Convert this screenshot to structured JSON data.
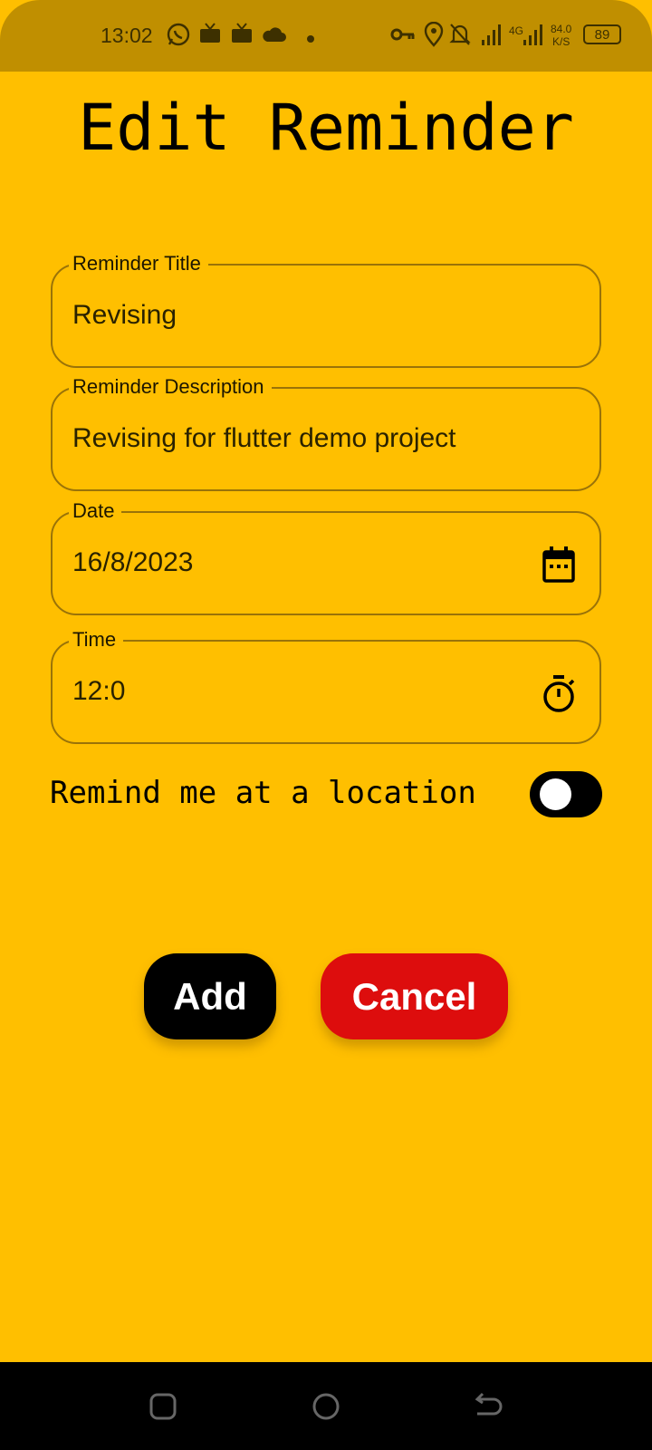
{
  "status_bar": {
    "time": "13:02",
    "network_type": "4G",
    "speed_value": "84.0",
    "speed_unit": "K/S",
    "battery": "89",
    "icons": [
      "whatsapp-icon",
      "tv-icon",
      "tv-icon",
      "cloud-icon",
      "dot-icon",
      "vpn-key-icon",
      "location-icon",
      "bell-off-icon",
      "signal-icon",
      "signal-icon"
    ]
  },
  "page": {
    "title": "Edit Reminder"
  },
  "fields": {
    "title": {
      "label": "Reminder Title",
      "value": "Revising"
    },
    "description": {
      "label": "Reminder Description",
      "value": "Revising for flutter demo project"
    },
    "date": {
      "label": "Date",
      "value": "16/8/2023",
      "icon": "calendar-icon"
    },
    "time": {
      "label": "Time",
      "value": "12:0",
      "icon": "timer-icon"
    }
  },
  "location_toggle": {
    "label": "Remind me at a location",
    "enabled": false
  },
  "buttons": {
    "add": "Add",
    "cancel": "Cancel"
  },
  "colors": {
    "background": "#FFBF00",
    "status_bar": "#C08F00",
    "cancel": "#DD0D0D",
    "add": "#000000"
  },
  "nav_bar": {
    "icons": [
      "recents-square-icon",
      "home-circle-icon",
      "back-arrow-icon"
    ]
  }
}
